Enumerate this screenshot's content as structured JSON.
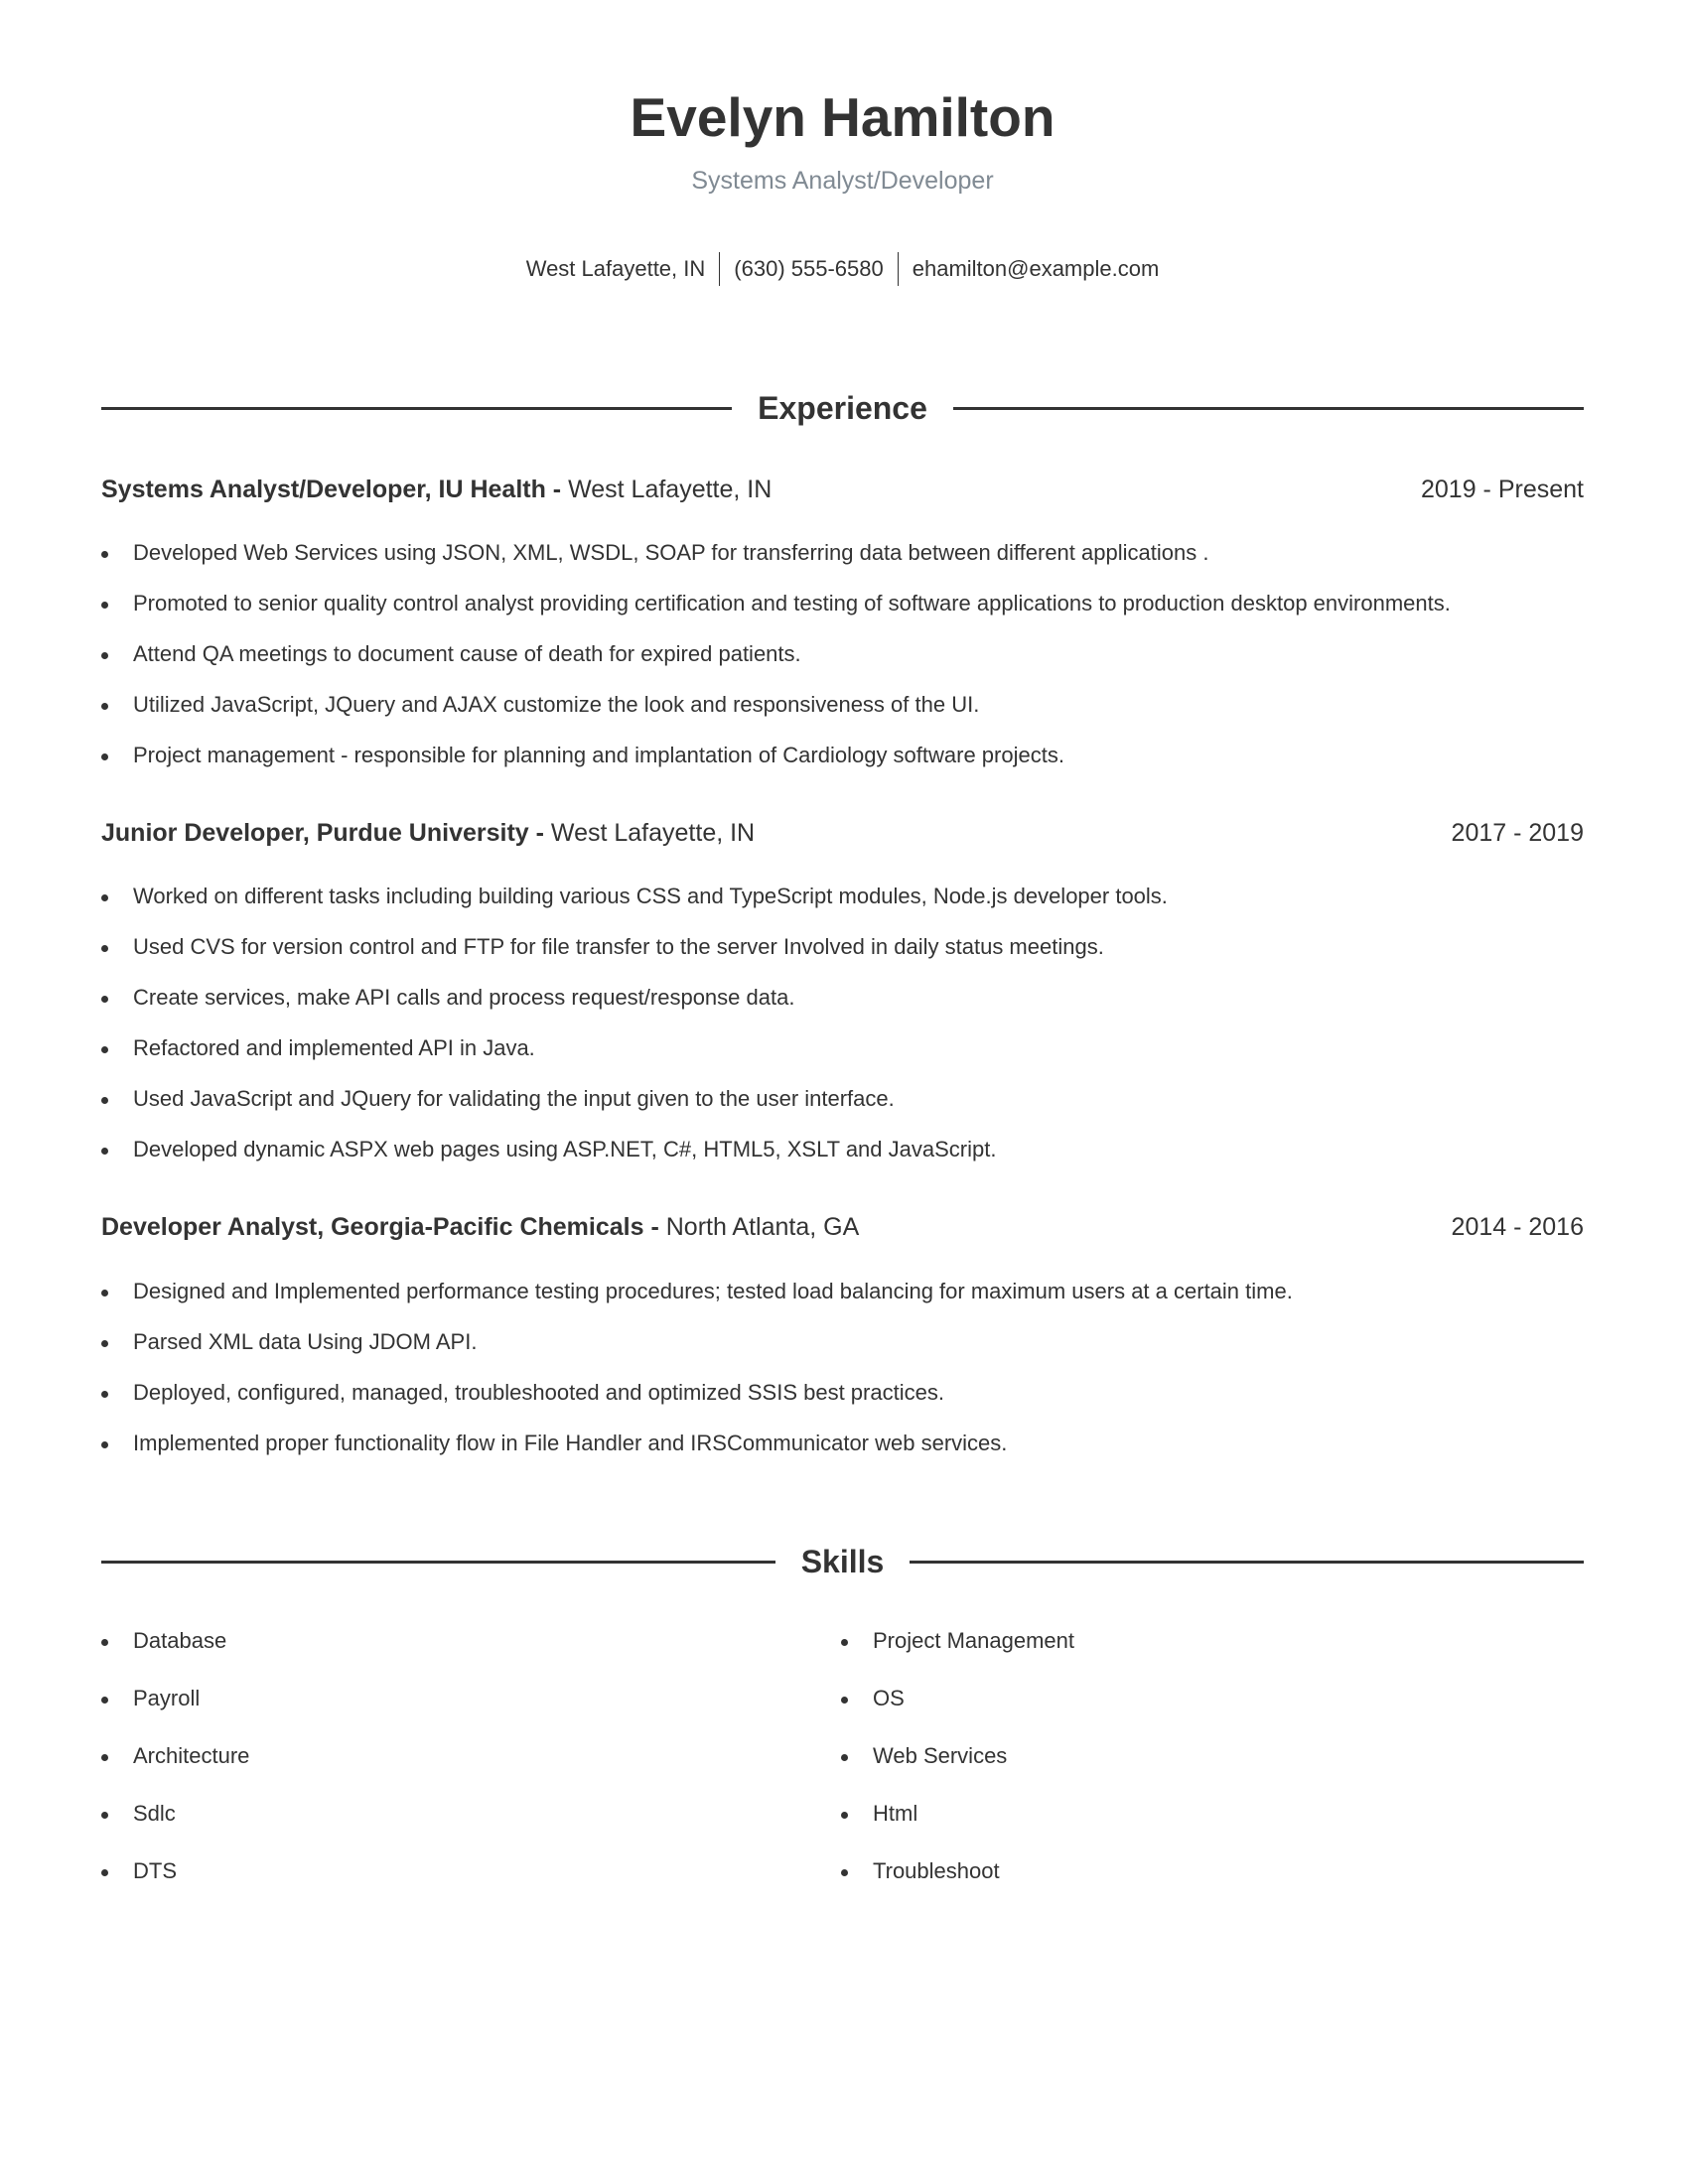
{
  "header": {
    "name": "Evelyn Hamilton",
    "title": "Systems Analyst/Developer",
    "contact": [
      "West Lafayette, IN",
      "(630) 555-6580",
      "ehamilton@example.com"
    ]
  },
  "experience": {
    "heading": "Experience",
    "jobs": [
      {
        "role_company": "Systems Analyst/Developer, IU Health -",
        "location": "West Lafayette, IN",
        "dates": "2019 - Present",
        "bullets": [
          "Developed Web Services using JSON, XML, WSDL, SOAP for transferring data between different applications .",
          "Promoted to senior quality control analyst providing certification and testing of software applications to production desktop environments.",
          "Attend QA meetings to document cause of death for expired patients.",
          "Utilized JavaScript, JQuery and AJAX customize the look and responsiveness of the UI.",
          "Project management - responsible for planning and implantation of Cardiology software projects."
        ]
      },
      {
        "role_company": "Junior Developer, Purdue University -",
        "location": "West Lafayette, IN",
        "dates": "2017 - 2019",
        "bullets": [
          "Worked on different tasks including building various CSS and TypeScript modules, Node.js developer tools.",
          "Used CVS for version control and FTP for file transfer to the server Involved in daily status meetings.",
          "Create services, make API calls and process request/response data.",
          "Refactored and implemented API in Java.",
          "Used JavaScript and JQuery for validating the input given to the user interface.",
          "Developed dynamic ASPX web pages using ASP.NET, C#, HTML5, XSLT and JavaScript."
        ]
      },
      {
        "role_company": "Developer Analyst, Georgia-Pacific Chemicals -",
        "location": "North Atlanta, GA",
        "dates": "2014 - 2016",
        "bullets": [
          "Designed and Implemented performance testing procedures; tested load balancing for maximum users at a certain time.",
          "Parsed XML data Using JDOM API.",
          "Deployed, configured, managed, troubleshooted and optimized SSIS best practices.",
          "Implemented proper functionality flow in File Handler and IRSCommunicator web services."
        ]
      }
    ]
  },
  "skills": {
    "heading": "Skills",
    "left": [
      "Database",
      "Payroll",
      "Architecture",
      "Sdlc",
      "DTS"
    ],
    "right": [
      "Project Management",
      "OS",
      "Web Services",
      "Html",
      "Troubleshoot"
    ]
  }
}
